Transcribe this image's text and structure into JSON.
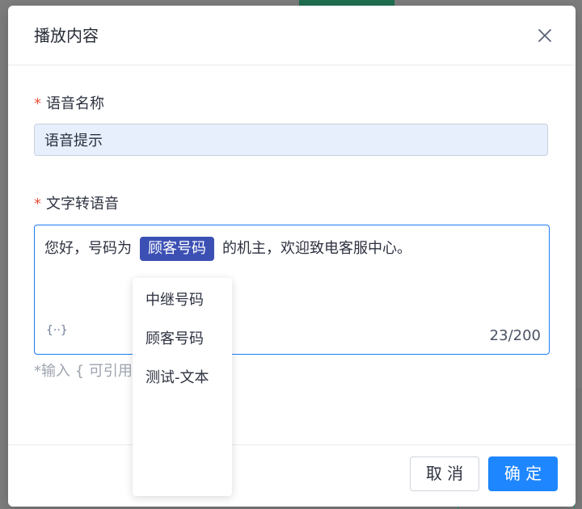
{
  "dialog": {
    "title": "播放内容",
    "close_icon": "close-icon"
  },
  "form": {
    "name_label": "语音名称",
    "name_value": "语音提示",
    "tts_label": "文字转语音",
    "required_mark": "*",
    "tts_text_before": "您好，号码为",
    "tts_tag": "顾客号码",
    "tts_text_after": "的机主，欢迎致电客服中心。",
    "variable_insert": "{··}",
    "char_count": "23/200",
    "hint": "*输入 { 可引用变"
  },
  "dropdown": {
    "items": [
      "中继号码",
      "顾客号码",
      "测试-文本"
    ]
  },
  "footer": {
    "cancel_label": "取 消",
    "ok_label": "确 定"
  },
  "colors": {
    "primary": "#1e86ff",
    "tag": "#3c50b4",
    "required": "#e5533c"
  }
}
